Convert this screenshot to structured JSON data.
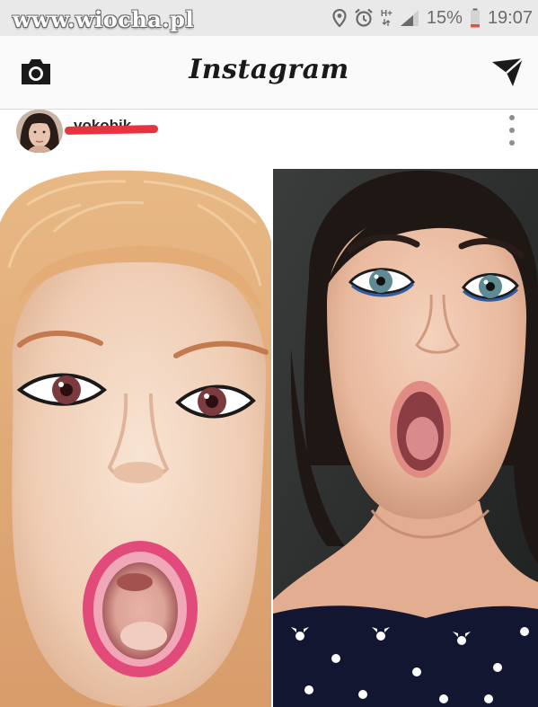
{
  "status_bar": {
    "watermark": "www.wiocha.pl",
    "network_type": "H+",
    "battery": "15%",
    "time": "19:07",
    "icons": [
      "location-icon",
      "alarm-icon",
      "signal-icon",
      "battery-icon"
    ]
  },
  "app_bar": {
    "title": "Instagram",
    "left_icon": "camera-icon",
    "right_icon": "send-icon"
  },
  "post": {
    "username": "vokobik",
    "username_redacted": true,
    "more_icon": "more-vertical-icon",
    "photos": [
      {
        "name": "left-photo"
      },
      {
        "name": "right-photo"
      }
    ]
  },
  "colors": {
    "status_bar_bg": "#e9e9e9",
    "app_bar_bg": "#fafafa",
    "redaction": "#e5343d",
    "icon_gray": "#6b6b6b"
  }
}
